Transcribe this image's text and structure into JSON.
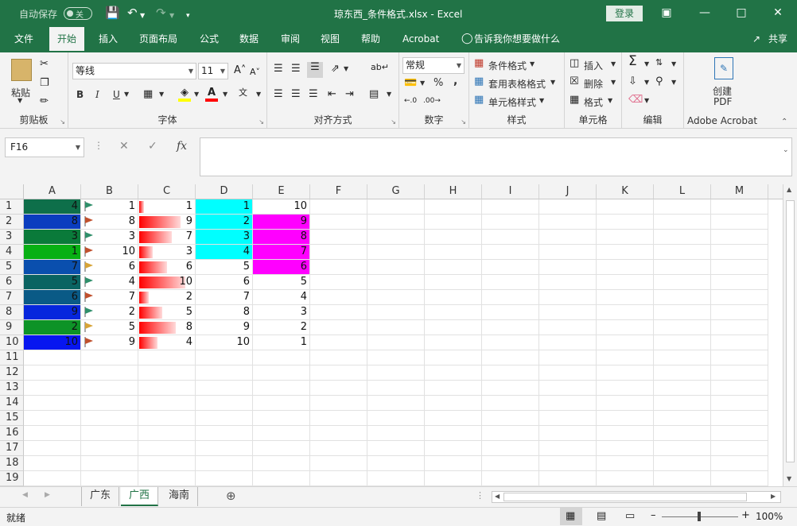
{
  "titlebar": {
    "autosave_label": "自动保存",
    "autosave_state": "关",
    "doc_title": "琼东西_条件格式.xlsx  -  Excel",
    "login_label": "登录"
  },
  "tabs": [
    {
      "label": "文件"
    },
    {
      "label": "开始"
    },
    {
      "label": "插入"
    },
    {
      "label": "页面布局"
    },
    {
      "label": "公式"
    },
    {
      "label": "数据"
    },
    {
      "label": "审阅"
    },
    {
      "label": "视图"
    },
    {
      "label": "帮助"
    },
    {
      "label": "Acrobat"
    },
    {
      "label": "告诉我你想要做什么"
    }
  ],
  "share_label": "共享",
  "ribbon": {
    "clipboard": {
      "paste": "粘贴",
      "label": "剪贴板"
    },
    "font": {
      "name": "等线",
      "size": "11",
      "bold": "B",
      "italic": "I",
      "underline": "U",
      "label": "字体"
    },
    "alignment": {
      "label": "对齐方式"
    },
    "number": {
      "format": "常规",
      "percent": "%",
      "comma": ",",
      "label": "数字"
    },
    "styles": {
      "conditional": "条件格式",
      "table": "套用表格格式",
      "cell_styles": "单元格样式",
      "label": "样式"
    },
    "cells": {
      "insert": "插入",
      "delete": "删除",
      "format": "格式",
      "label": "单元格"
    },
    "editing": {
      "label": "编辑"
    },
    "acrobat": {
      "create": "创建",
      "pdf": "PDF",
      "label": "Adobe Acrobat"
    }
  },
  "formula_bar": {
    "name_box": "F16",
    "value": ""
  },
  "grid": {
    "columns": [
      "A",
      "B",
      "C",
      "D",
      "E",
      "F",
      "G",
      "H",
      "I",
      "J",
      "K",
      "L",
      "M"
    ],
    "rows": [
      "1",
      "2",
      "3",
      "4",
      "5",
      "6",
      "7",
      "8",
      "9",
      "10",
      "11",
      "12",
      "13",
      "14",
      "15",
      "16",
      "17",
      "18",
      "19"
    ],
    "colA": [
      4,
      8,
      3,
      1,
      7,
      5,
      6,
      9,
      2,
      10
    ],
    "colA_colors": [
      "#0e6f4a",
      "#0b3dbf",
      "#0a7a3a",
      "#08b014",
      "#0a4fae",
      "#0a6462",
      "#0a5a86",
      "#0626dd",
      "#0d9327",
      "#0716f0"
    ],
    "colB": [
      1,
      8,
      3,
      10,
      6,
      4,
      7,
      2,
      5,
      9
    ],
    "colB_flag_colors": [
      "#2f8f6a",
      "#c0502d",
      "#2f8f6a",
      "#c0502d",
      "#d7a437",
      "#2f8f6a",
      "#c0502d",
      "#2f8f6a",
      "#d7a437",
      "#c0502d"
    ],
    "colC": [
      1,
      9,
      7,
      3,
      6,
      10,
      2,
      5,
      8,
      4
    ],
    "colC_max": 10,
    "colD": [
      1,
      2,
      3,
      4,
      5,
      6,
      7,
      8,
      9,
      10
    ],
    "colD_highlight": "#00ffff",
    "colE": [
      10,
      9,
      8,
      7,
      6,
      5,
      4,
      3,
      2,
      1
    ],
    "colE_highlight": "#ff00ff"
  },
  "sheets": [
    {
      "label": "广东"
    },
    {
      "label": "广西"
    },
    {
      "label": "海南"
    }
  ],
  "status": {
    "ready": "就绪",
    "zoom": "100%"
  },
  "colors": {
    "brand": "#217346",
    "ribbon_bg": "#f3f3f3"
  }
}
